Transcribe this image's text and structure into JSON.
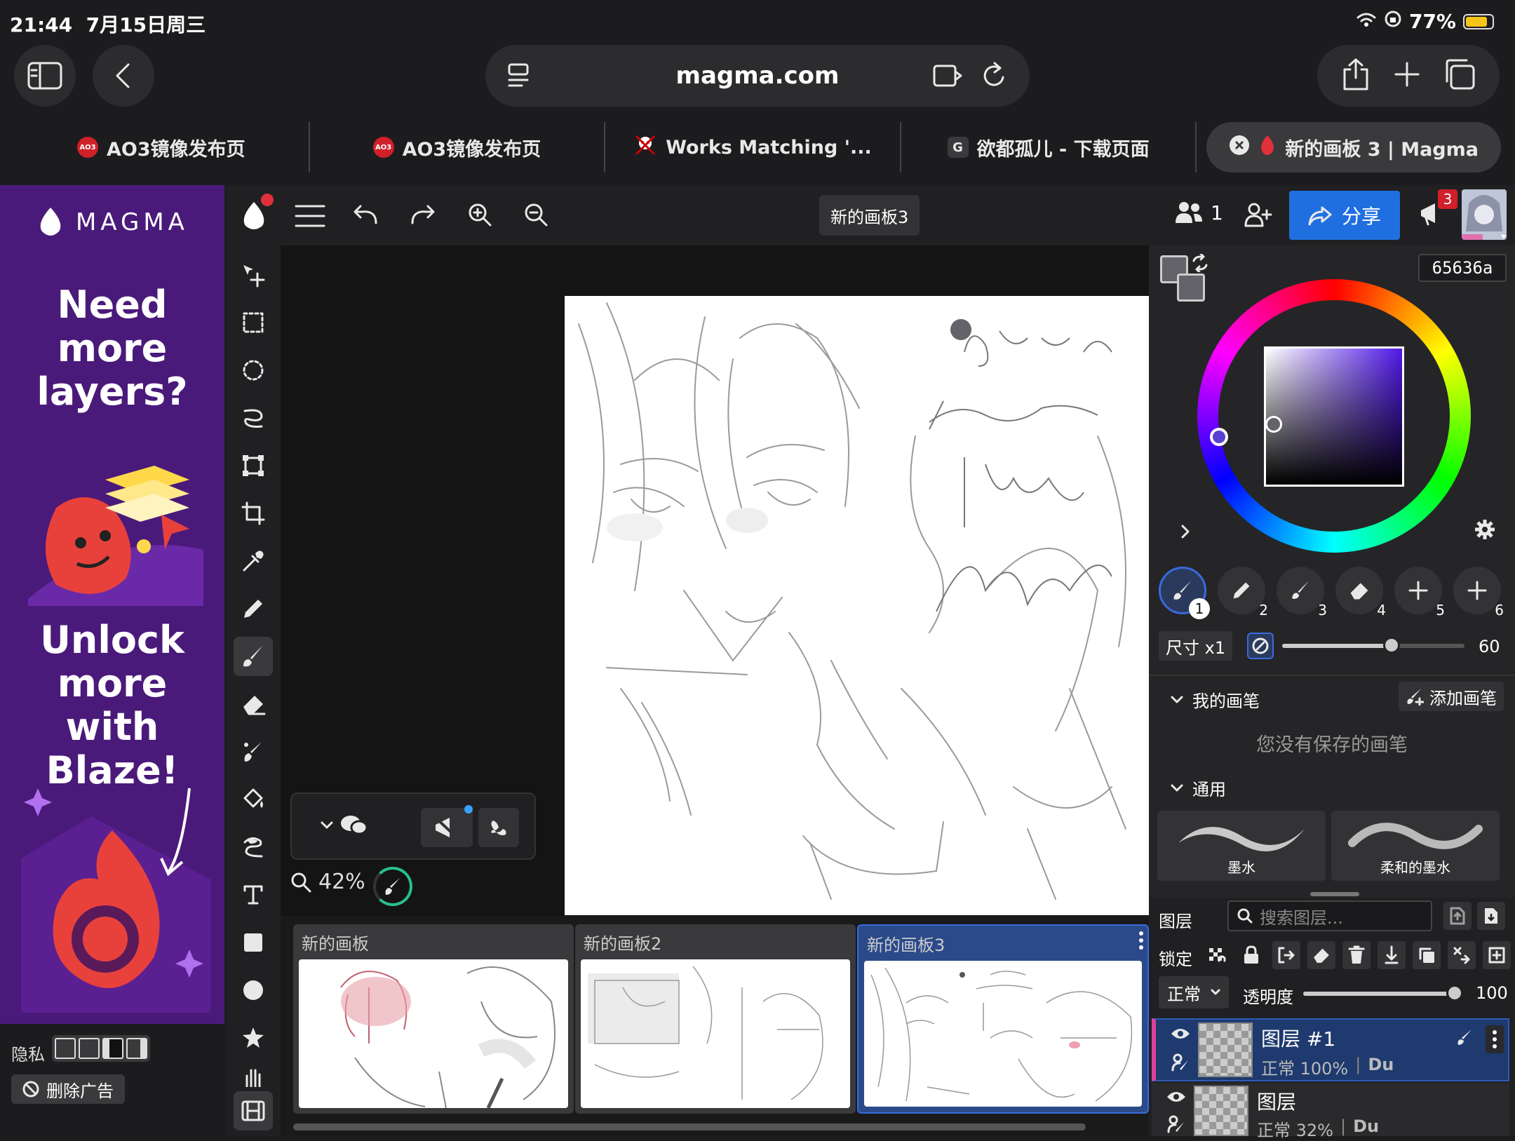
{
  "status_bar": {
    "time": "21:44",
    "date": "7月15日周三",
    "battery": "77%"
  },
  "browser": {
    "url": "magma.com",
    "tabs": [
      {
        "label": "AO3镜像发布页",
        "icon": "ao3-icon"
      },
      {
        "label": "AO3镜像发布页",
        "icon": "ao3-icon"
      },
      {
        "label": "Works Matching '...",
        "icon": "ao3-logo-icon"
      },
      {
        "label": "欲都孤儿 - 下载页面",
        "icon": "g-icon"
      },
      {
        "label": "新的画板 3 | Magma",
        "icon": "magma-icon"
      }
    ]
  },
  "ad": {
    "brand": "MAGMA",
    "line1": "Need more layers?",
    "line2": "Unlock more with Blaze!",
    "privacy": "隐私",
    "remove_ads": "删除广告"
  },
  "app": {
    "board_title": "新的画板3",
    "users_count": "1",
    "share_label": "分享",
    "notification_count": "3",
    "zoom": "42%"
  },
  "color": {
    "hex": "65636a",
    "primary": "#65636a",
    "secondary": "#65636a"
  },
  "brush_slots": [
    "1",
    "2",
    "3",
    "4",
    "5",
    "6"
  ],
  "size": {
    "label": "尺寸 x1",
    "value": "60",
    "fraction": 0.6
  },
  "my_brushes": {
    "title": "我的画笔",
    "add": "添加画笔",
    "empty": "您没有保存的画笔"
  },
  "general": {
    "title": "通用",
    "brushes": [
      "墨水",
      "柔和的墨水"
    ]
  },
  "layers": {
    "title": "图层",
    "search_placeholder": "搜索图层...",
    "lock": "锁定",
    "blend": "正常",
    "opacity_label": "透明度",
    "opacity": "100",
    "items": [
      {
        "name": "图层 #1",
        "meta": "正常 100%",
        "author": "Du"
      },
      {
        "name": "图层",
        "meta": "正常 32%",
        "author": "Du"
      }
    ]
  },
  "boards": [
    {
      "name": "新的画板"
    },
    {
      "name": "新的画板2"
    },
    {
      "name": "新的画板3"
    }
  ]
}
